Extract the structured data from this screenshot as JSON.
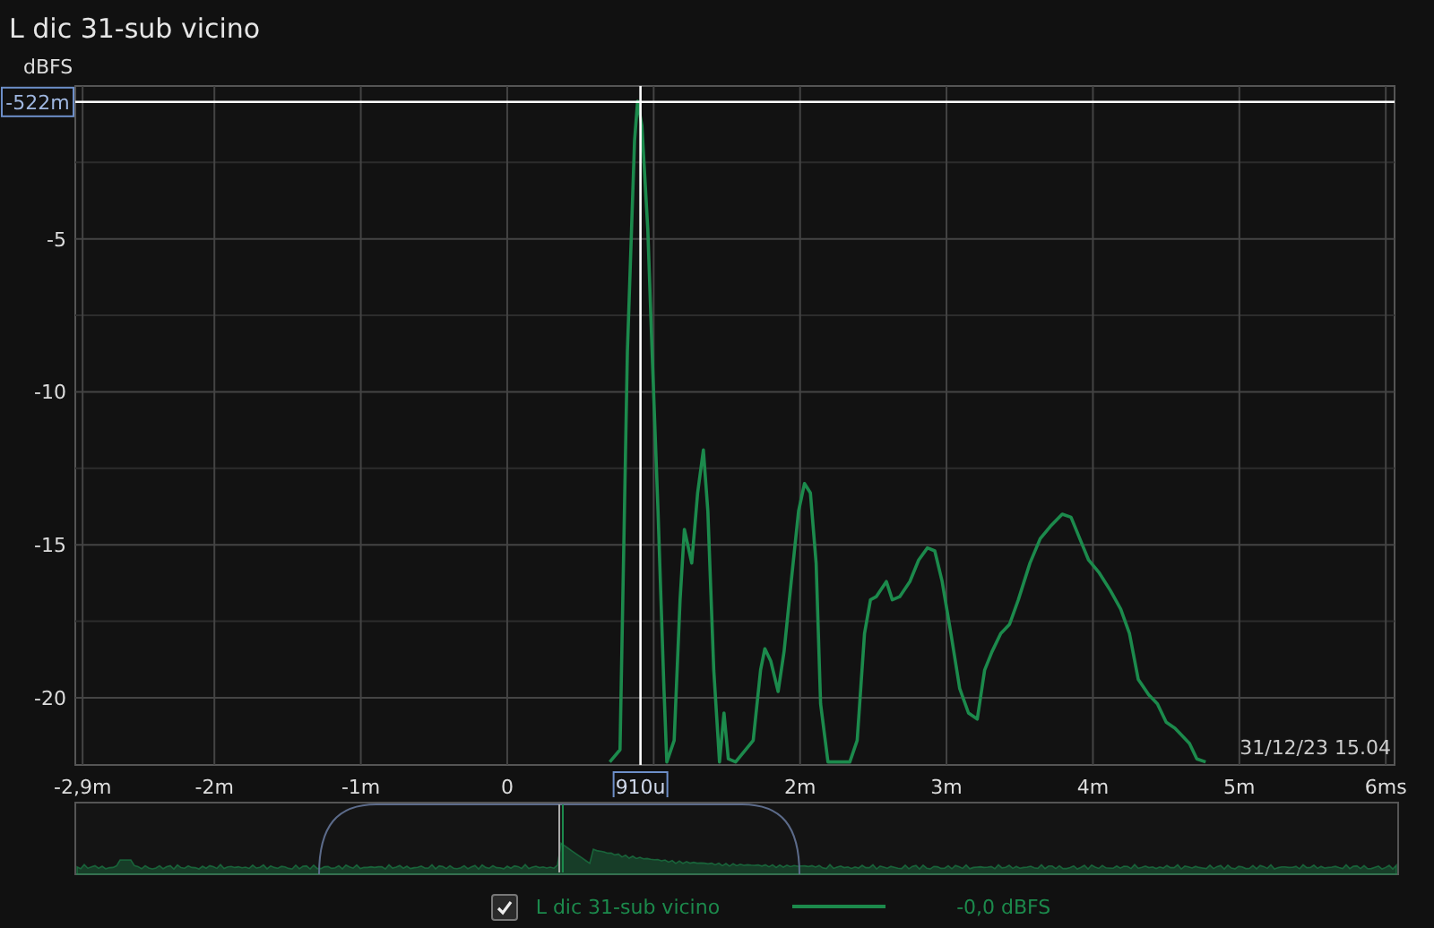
{
  "window": {
    "title": "L dic 31-sub vicino"
  },
  "chart": {
    "chart_data": {
      "type": "line",
      "ylabel": "dBFS",
      "xlim": [
        -2.95,
        6.06
      ],
      "ylim": [
        -22.2,
        0
      ],
      "xticks": [
        {
          "value": -2.9,
          "label": "-2,9m"
        },
        {
          "value": -2,
          "label": "-2m"
        },
        {
          "value": -1,
          "label": "-1m"
        },
        {
          "value": 0,
          "label": "0"
        },
        {
          "value": 2,
          "label": "2m"
        },
        {
          "value": 3,
          "label": "3m"
        },
        {
          "value": 4,
          "label": "4m"
        },
        {
          "value": 5,
          "label": "5m"
        },
        {
          "value": 6,
          "label": "6ms"
        }
      ],
      "yticks": [
        -5,
        -10,
        -15,
        -20
      ],
      "x": [
        0.7,
        0.77,
        0.82,
        0.87,
        0.89,
        0.92,
        0.96,
        0.99,
        1.03,
        1.07,
        1.09,
        1.14,
        1.18,
        1.21,
        1.26,
        1.3,
        1.34,
        1.37,
        1.41,
        1.45,
        1.48,
        1.51,
        1.56,
        1.68,
        1.73,
        1.76,
        1.8,
        1.85,
        1.89,
        1.94,
        1.99,
        2.03,
        2.07,
        2.11,
        2.14,
        2.19,
        2.34,
        2.39,
        2.44,
        2.48,
        2.52,
        2.59,
        2.63,
        2.68,
        2.75,
        2.81,
        2.87,
        2.92,
        2.97,
        3.03,
        3.09,
        3.15,
        3.21,
        3.26,
        3.31,
        3.37,
        3.43,
        3.49,
        3.57,
        3.64,
        3.71,
        3.79,
        3.85,
        3.91,
        3.97,
        4.04,
        4.12,
        4.19,
        4.25,
        4.31,
        4.38,
        4.44,
        4.5,
        4.56,
        4.62,
        4.66,
        4.71,
        4.77
      ],
      "series": [
        {
          "name": "L dic 31-sub vicino",
          "color": "#1c8a4c",
          "values": [
            -22.1,
            -21.7,
            -8.7,
            -1.8,
            -0.5,
            -1.3,
            -4.7,
            -8.7,
            -13.9,
            -19.7,
            -22.1,
            -21.4,
            -16.8,
            -14.5,
            -15.6,
            -13.3,
            -11.9,
            -13.9,
            -19.1,
            -22.1,
            -20.5,
            -22.0,
            -22.1,
            -21.4,
            -19.1,
            -18.4,
            -18.8,
            -19.8,
            -18.5,
            -16.2,
            -13.9,
            -13.0,
            -13.3,
            -15.6,
            -20.2,
            -22.1,
            -22.1,
            -21.4,
            -17.9,
            -16.8,
            -16.7,
            -16.2,
            -16.8,
            -16.7,
            -16.2,
            -15.5,
            -15.1,
            -15.2,
            -16.2,
            -17.9,
            -19.7,
            -20.5,
            -20.7,
            -19.1,
            -18.5,
            -17.9,
            -17.6,
            -16.8,
            -15.6,
            -14.8,
            -14.4,
            -14.0,
            -14.1,
            -14.8,
            -15.5,
            -15.9,
            -16.5,
            -17.1,
            -17.9,
            -19.4,
            -19.9,
            -20.2,
            -20.8,
            -21.0,
            -21.3,
            -21.5,
            -22.0,
            -22.1
          ]
        }
      ],
      "grid": true,
      "ref_lines": [
        {
          "axis": "x",
          "value": 0.91,
          "label": "910u"
        },
        {
          "axis": "y",
          "value": -0.522,
          "label": "-522m"
        }
      ]
    },
    "timestamp": "31/12/23 15.04"
  },
  "legend": [
    {
      "checked": true,
      "reading": "-0,0 dBFS"
    }
  ]
}
